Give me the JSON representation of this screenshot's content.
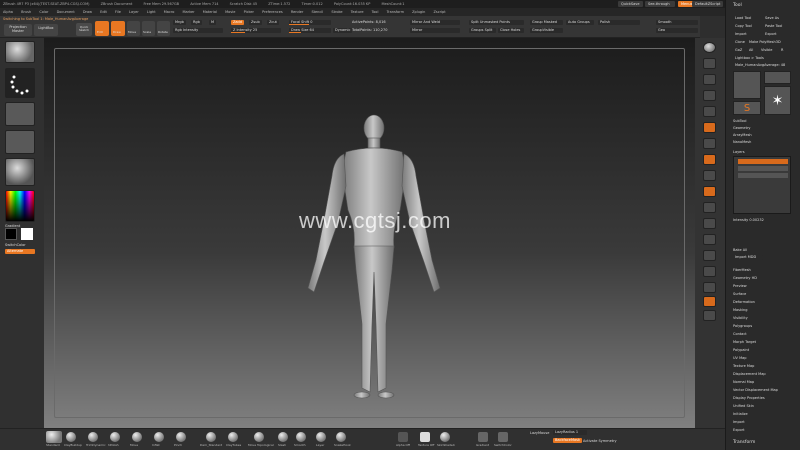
{
  "title_bar": {
    "items": [
      "ZBrush 4R7 P3 (x64)(TEST-SEAT-ZBP4-CGSJ.COM)",
      "ZBrush Document",
      "Free Mem 29.567GB",
      "Active Mem 714",
      "Scratch Disk 45",
      "ZTime:1.572",
      "Timer:0.012",
      "PolyCount:16.035 KP",
      "MeshCount:1"
    ]
  },
  "top_right": {
    "quicksave": "QuickSave",
    "see_through": "See-through  0",
    "menus": "Menus",
    "default_zscript": "DefaultZScript"
  },
  "menu_bar": [
    "Alpha",
    "Brush",
    "Color",
    "Document",
    "Draw",
    "Edit",
    "File",
    "Layer",
    "Light",
    "Macro",
    "Marker",
    "Material",
    "Movie",
    "Picker",
    "Preferences",
    "Render",
    "Stencil",
    "Stroke",
    "Texture",
    "Tool",
    "Transform",
    "Zplugin",
    "Zscript"
  ],
  "status": {
    "switching": "Switching to SubTool 1: Male_HumanAvgAverage"
  },
  "toolbar": {
    "projection_master": "Projection Master",
    "lightbox": "LightBox",
    "quick_sketch": "Quick Sketch",
    "edit": "Edit",
    "draw": "Draw",
    "move": "Move",
    "scale": "Scale",
    "rotate": "Rotate",
    "mrgb": "Mrgb",
    "rgb": "Rgb",
    "m": "M",
    "zadd": "Zadd",
    "zsub": "Zsub",
    "zcut": "Zcut",
    "rgb_intensity": "Rgb Intensity",
    "z_intensity": "Z Intensity 25",
    "focal_shift": "Focal Shift 0",
    "draw_size": "Draw Size 64",
    "dynamic": "Dynamic",
    "active_points": "ActivePoints: 8,016",
    "total_points": "TotalPoints: 110,270",
    "mirror_weld": "Mirror And Weld",
    "mirror": "Mirror",
    "split_unmasked": "Split Unmasked Points",
    "groups_split": "Groups Split",
    "close_holes": "Close Holes",
    "group_masked": "Group Masked",
    "auto_groups": "Auto Groups",
    "groups_visible": "GroupVisible",
    "polish": "Polish",
    "smooth": "Smooth",
    "geo": "Geo"
  },
  "left_shelf": {
    "gradient_label": "Gradient",
    "switch_color": "SwitchColor",
    "alternate": "Alternate"
  },
  "watermark": "www.cgtsj.com",
  "tray": {
    "title": "Tool",
    "load_tool": "Load Tool",
    "save_as": "Save As",
    "copy_tool": "Copy Tool",
    "paste_tool": "Paste Tool",
    "import": "Import",
    "export": "Export",
    "clone": "Clone",
    "make_polymesh": "Make PolyMesh3D",
    "goz": "GoZ",
    "all": "All",
    "visible": "Visible",
    "r": "R",
    "lightbox_tools": "Lightbox > Tools",
    "current_tool": "Male_HumanAvgAverage: 48",
    "sections": [
      "SubTool",
      "Geometry",
      "ArrayMesh",
      "NanoMesh"
    ],
    "layers_label": "Layers",
    "intensity": "Intensity 0.00232",
    "bake_all": "Bake All",
    "import_mdd": "Import MDD",
    "lower_sections": [
      "FiberMesh",
      "Geometry HD",
      "Preview",
      "Surface",
      "Deformation",
      "Masking",
      "Visibility",
      "Polygroups",
      "Contact",
      "Morph Target",
      "Polypaint",
      "UV Map",
      "Texture Map",
      "Displacement Map",
      "Normal Map",
      "Vector Displacement Map",
      "Display Properties",
      "Unified Skin",
      "Initialize",
      "Import",
      "Export"
    ],
    "transform": "Transform"
  },
  "bottom": {
    "brushes": [
      "Standard",
      "ClayBuildup",
      "TrimDynamic",
      "hPolish",
      "Move",
      "Inflat",
      "Pinch",
      "Dam_Standard",
      "ClayTubes",
      "Move Topological",
      "Slash",
      "Smooth",
      "Layer",
      "SnakeHook"
    ],
    "alphas": [
      "Alpha Off",
      "Texture Off",
      "SkinShade4"
    ],
    "colors": [
      "Gradient",
      "SwitchColor",
      "Alternate"
    ],
    "lazymouse": "LazyMouse",
    "lazyradius": "LazyRadius 1",
    "backfacemask": "BackfaceMask",
    "activate_symmetry": "Activate Symmetry"
  },
  "accent": "#e87722"
}
